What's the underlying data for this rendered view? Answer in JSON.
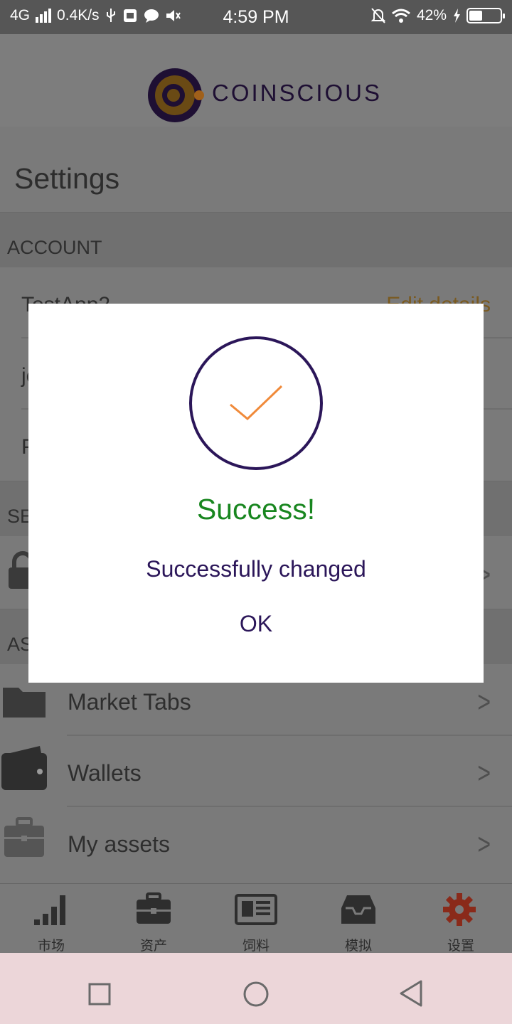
{
  "status_bar": {
    "network": "4G",
    "speed": "0.4K/s",
    "time": "4:59 PM",
    "battery": "42%",
    "battery_level": 0.42
  },
  "app": {
    "brand": "COINSCIOUS",
    "page_title": "Settings"
  },
  "account": {
    "section_label": "ACCOUNT",
    "name": "TestApp2",
    "edit_label": "Edit details",
    "row2_partial": "je",
    "row3_partial": "P"
  },
  "security": {
    "section_partial": "SE"
  },
  "assets": {
    "section_partial": "AS",
    "items": [
      {
        "label": "Market Tabs",
        "icon": "folder-icon"
      },
      {
        "label": "Wallets",
        "icon": "wallet-icon"
      },
      {
        "label": "My assets",
        "icon": "briefcase-icon"
      }
    ]
  },
  "tabs": [
    {
      "label": "市场",
      "icon": "signal-bars-icon"
    },
    {
      "label": "资产",
      "icon": "briefcase-icon"
    },
    {
      "label": "饲料",
      "icon": "newspaper-icon"
    },
    {
      "label": "模拟",
      "icon": "inbox-icon"
    },
    {
      "label": "设置",
      "icon": "gear-icon",
      "active": true
    }
  ],
  "dialog": {
    "title": "Success!",
    "message": "Successfully changed",
    "ok_label": "OK"
  },
  "colors": {
    "success_green": "#18861f",
    "brand_purple": "#2b1659",
    "accent_orange": "#f08a3a",
    "gear_red": "#8a2a1a"
  }
}
